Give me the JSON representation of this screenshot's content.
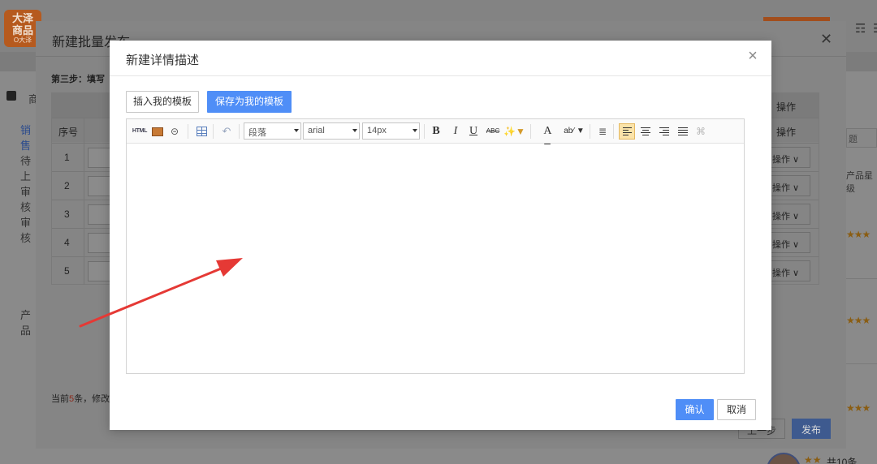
{
  "background": {
    "logo_text": "大泽商品",
    "logo_sub": "O大泽",
    "left_items": [
      "商",
      "销售",
      "待上",
      "审核",
      "审核",
      "产品"
    ],
    "right_search_placeholder": "题",
    "right_header": "产品星级",
    "bottom_count": "共10条"
  },
  "outer_modal": {
    "title": "新建批量发布",
    "step_label": "第三步：填写",
    "table": {
      "col_index": "序号",
      "col_action": "操作",
      "rows": [
        {
          "num": "1",
          "action": "操作"
        },
        {
          "num": "2",
          "action": "操作"
        },
        {
          "num": "3",
          "action": "操作"
        },
        {
          "num": "4",
          "action": "操作"
        },
        {
          "num": "5",
          "action": "操作"
        }
      ]
    },
    "footer_prefix": "当前",
    "footer_count": "5",
    "footer_suffix": "条，修改",
    "prev_label": "上一步",
    "publish_label": "发布"
  },
  "dialog": {
    "title": "新建详情描述",
    "insert_template_label": "插入我的模板",
    "save_template_label": "保存为我的模板",
    "toolbar": {
      "html_label": "HTML",
      "paragraph_value": "段落",
      "font_value": "arial",
      "size_value": "14px",
      "bold_label": "B",
      "italic_label": "I",
      "underline_label": "U",
      "strike_label": "ABC",
      "font_color_label": "A",
      "bg_color_label": "ab"
    },
    "confirm_label": "确认",
    "cancel_label": "取消"
  },
  "colors": {
    "primary": "#4f8ef7",
    "arrow": "#e53935",
    "active_align_bg": "#fbe3a9"
  }
}
